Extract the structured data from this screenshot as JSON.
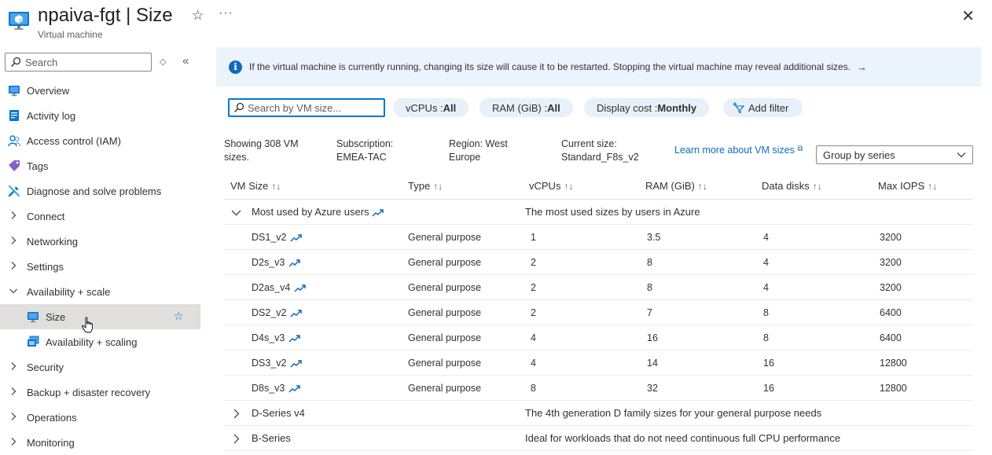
{
  "header": {
    "title": "npaiva-fgt | Size",
    "subtitle": "Virtual machine",
    "favorite_icon": "star-outline-icon",
    "more_icon": "ellipsis-icon",
    "close_icon": "close-icon"
  },
  "sidebar": {
    "search_placeholder": "Search",
    "items": [
      {
        "label": "Overview",
        "icon": "monitor-icon",
        "type": "top"
      },
      {
        "label": "Activity log",
        "icon": "activity-log-icon",
        "type": "top"
      },
      {
        "label": "Access control (IAM)",
        "icon": "people-icon",
        "type": "top"
      },
      {
        "label": "Tags",
        "icon": "tag-icon",
        "type": "top"
      },
      {
        "label": "Diagnose and solve problems",
        "icon": "wrench-icon",
        "type": "top"
      },
      {
        "label": "Connect",
        "type": "collapsed"
      },
      {
        "label": "Networking",
        "type": "collapsed"
      },
      {
        "label": "Settings",
        "type": "collapsed"
      },
      {
        "label": "Availability + scale",
        "type": "expanded"
      },
      {
        "label": "Size",
        "icon": "monitor-icon",
        "type": "sub",
        "active": true
      },
      {
        "label": "Availability + scaling",
        "icon": "scale-set-icon",
        "type": "sub"
      },
      {
        "label": "Security",
        "type": "collapsed"
      },
      {
        "label": "Backup + disaster recovery",
        "type": "collapsed"
      },
      {
        "label": "Operations",
        "type": "collapsed"
      },
      {
        "label": "Monitoring",
        "type": "collapsed"
      }
    ]
  },
  "info_bar": {
    "text": "If the virtual machine is currently running, changing its size will cause it to be restarted. Stopping the virtual machine may reveal additional sizes.",
    "arrow": "→"
  },
  "filters": {
    "search_placeholder": "Search by VM size...",
    "vcpus": {
      "label": "vCPUs : ",
      "value": "All"
    },
    "ram": {
      "label": "RAM (GiB) : ",
      "value": "All"
    },
    "cost": {
      "label": "Display cost : ",
      "value": "Monthly"
    },
    "add_filter": "Add filter"
  },
  "summary": {
    "showing": "Showing 308 VM sizes.",
    "subscription_label": "Subscription:",
    "subscription_value": "EMEA-TAC",
    "region": "Region: West Europe",
    "current_size_label": "Current size:",
    "current_size_value": "Standard_F8s_v2",
    "learn_more": "Learn more about VM sizes",
    "group_by": "Group by series"
  },
  "table": {
    "headers": [
      "VM Size",
      "Type",
      "vCPUs",
      "RAM (GiB)",
      "Data disks",
      "Max IOPS"
    ],
    "sort_glyph": "↑↓",
    "groups": [
      {
        "name": "Most used by Azure users",
        "description": "The most used sizes by users in Azure",
        "expanded": true,
        "rows": [
          {
            "size": "DS1_v2",
            "type": "General purpose",
            "vcpus": "1",
            "ram": "3.5",
            "disks": "4",
            "iops": "3200"
          },
          {
            "size": "D2s_v3",
            "type": "General purpose",
            "vcpus": "2",
            "ram": "8",
            "disks": "4",
            "iops": "3200"
          },
          {
            "size": "D2as_v4",
            "type": "General purpose",
            "vcpus": "2",
            "ram": "8",
            "disks": "4",
            "iops": "3200"
          },
          {
            "size": "DS2_v2",
            "type": "General purpose",
            "vcpus": "2",
            "ram": "7",
            "disks": "8",
            "iops": "6400"
          },
          {
            "size": "D4s_v3",
            "type": "General purpose",
            "vcpus": "4",
            "ram": "16",
            "disks": "8",
            "iops": "6400"
          },
          {
            "size": "DS3_v2",
            "type": "General purpose",
            "vcpus": "4",
            "ram": "14",
            "disks": "16",
            "iops": "12800"
          },
          {
            "size": "D8s_v3",
            "type": "General purpose",
            "vcpus": "8",
            "ram": "32",
            "disks": "16",
            "iops": "12800"
          }
        ]
      },
      {
        "name": "D-Series v4",
        "description": "The 4th generation D family sizes for your general purpose needs",
        "expanded": false,
        "rows": []
      },
      {
        "name": "B-Series",
        "description": "Ideal for workloads that do not need continuous full CPU performance",
        "expanded": false,
        "rows": []
      }
    ]
  },
  "colors": {
    "accent": "#0078d4",
    "link": "#0f6cbd",
    "info_bg": "#ebf3fc",
    "pill_bg": "#e8f0fa",
    "active_nav": "#e1dfdd"
  }
}
